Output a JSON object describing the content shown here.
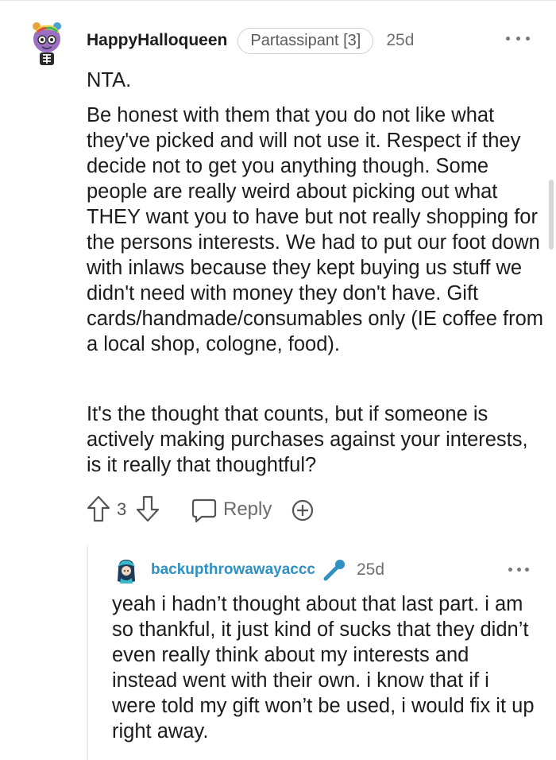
{
  "comment": {
    "username": "HappyHalloqueen",
    "flair": "Partassipant [3]",
    "timestamp": "25d",
    "paragraphs": [
      "NTA.",
      "Be honest with them that you do not like what they've picked and will not use it. Respect if they decide not to get you anything though. Some people are really weird about picking out what THEY want you to have but not really shopping for the persons interests. We had to put our foot down with inlaws because they kept buying us stuff we didn't need with money they don't have. Gift cards/handmade/consumables only (IE coffee from a local shop, cologne, food).",
      "It's the thought that counts, but if someone is actively making purchases against your interests, is it really that thoughtful?"
    ],
    "vote_count": "3",
    "reply_label": "Reply"
  },
  "reply": {
    "username": "backupthrowawayaccc",
    "timestamp": "25d",
    "text": "yeah i hadn’t thought about that last part. i am so thankful, it just kind of sucks that they didn’t even really think about my interests and instead went with their own. i know that if i were told my gift won’t be used, i would fix it up right away."
  },
  "icons": {
    "upvote": "upvote-arrow-icon",
    "downvote": "downvote-arrow-icon",
    "reply": "speech-bubble-icon",
    "award": "plus-award-icon",
    "more": "three-dots-icon",
    "op_badge": "microphone-icon"
  },
  "colors": {
    "reply_username": "#2f90c2",
    "mic_icon": "#2f90c2"
  }
}
